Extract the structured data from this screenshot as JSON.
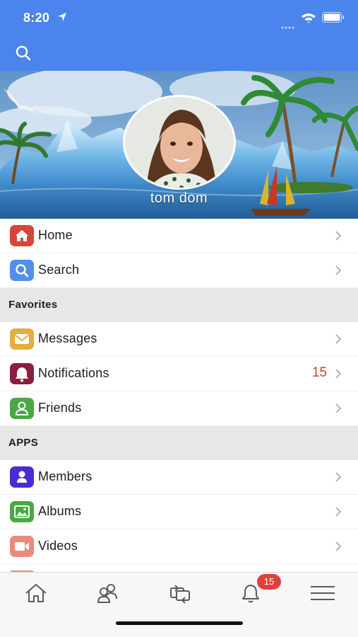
{
  "status_bar": {
    "time": "8:20"
  },
  "profile": {
    "name": "tom dom"
  },
  "menu": {
    "home": {
      "label": "Home"
    },
    "search": {
      "label": "Search"
    },
    "favorites_header": "Favorites",
    "messages": {
      "label": "Messages"
    },
    "notifications": {
      "label": "Notifications",
      "count": "15"
    },
    "friends": {
      "label": "Friends"
    },
    "apps_header": "APPS",
    "members": {
      "label": "Members"
    },
    "albums": {
      "label": "Albums"
    },
    "videos": {
      "label": "Videos"
    }
  },
  "tab_bar": {
    "notifications_badge": "15",
    "tabs": [
      "home-icon",
      "friends-icon",
      "activity-icon",
      "bell-icon",
      "hamburger-menu-icon"
    ]
  },
  "colors": {
    "header_blue": "#4a84ec",
    "home_icon": "#d8433b",
    "search_icon": "#4f8ff0",
    "messages_icon": "#e5ad3f",
    "notifications_icon": "#8b1f3d",
    "friends_icon": "#49a846",
    "members_icon": "#4a2bd6",
    "albums_icon": "#49a846",
    "videos_icon": "#e88b7d",
    "count_red": "#d5402d"
  }
}
